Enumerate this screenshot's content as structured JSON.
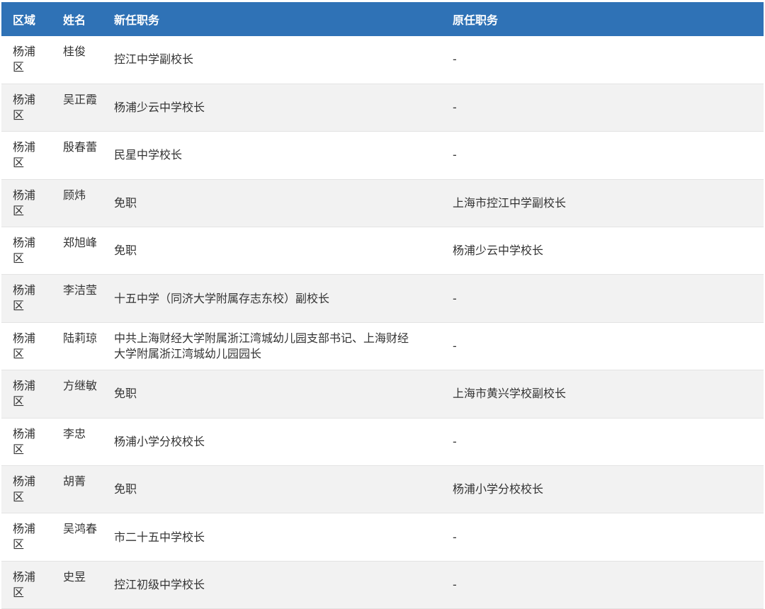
{
  "headers": {
    "region": "区域",
    "name": "姓名",
    "new_post": "新任职务",
    "old_post": "原任职务"
  },
  "rows": [
    {
      "region": "杨浦区",
      "name": "桂俊",
      "new_post": "控江中学副校长",
      "old_post": "-"
    },
    {
      "region": "杨浦区",
      "name": "吴正霞",
      "new_post": "杨浦少云中学校长",
      "old_post": "-"
    },
    {
      "region": "杨浦区",
      "name": "殷春蕾",
      "new_post": "民星中学校长",
      "old_post": "-"
    },
    {
      "region": "杨浦区",
      "name": "顾炜",
      "new_post": "免职",
      "old_post": "上海市控江中学副校长"
    },
    {
      "region": "杨浦区",
      "name": "郑旭峰",
      "new_post": "免职",
      "old_post": "杨浦少云中学校长"
    },
    {
      "region": "杨浦区",
      "name": "李洁莹",
      "new_post": "十五中学（同济大学附属存志东校）副校长",
      "old_post": "-"
    },
    {
      "region": "杨浦区",
      "name": "陆莉琼",
      "new_post": "中共上海财经大学附属浙江湾城幼儿园支部书记、上海财经大学附属浙江湾城幼儿园园长",
      "old_post": "-"
    },
    {
      "region": "杨浦区",
      "name": "方继敏",
      "new_post": "免职",
      "old_post": "上海市黄兴学校副校长"
    },
    {
      "region": "杨浦区",
      "name": "李忠",
      "new_post": "杨浦小学分校校长",
      "old_post": "-"
    },
    {
      "region": "杨浦区",
      "name": "胡菁",
      "new_post": "免职",
      "old_post": "杨浦小学分校校长"
    },
    {
      "region": "杨浦区",
      "name": "吴鸿春",
      "new_post": "市二十五中学校长",
      "old_post": "-"
    },
    {
      "region": "杨浦区",
      "name": "史昱",
      "new_post": "控江初级中学校长",
      "old_post": "-"
    }
  ]
}
